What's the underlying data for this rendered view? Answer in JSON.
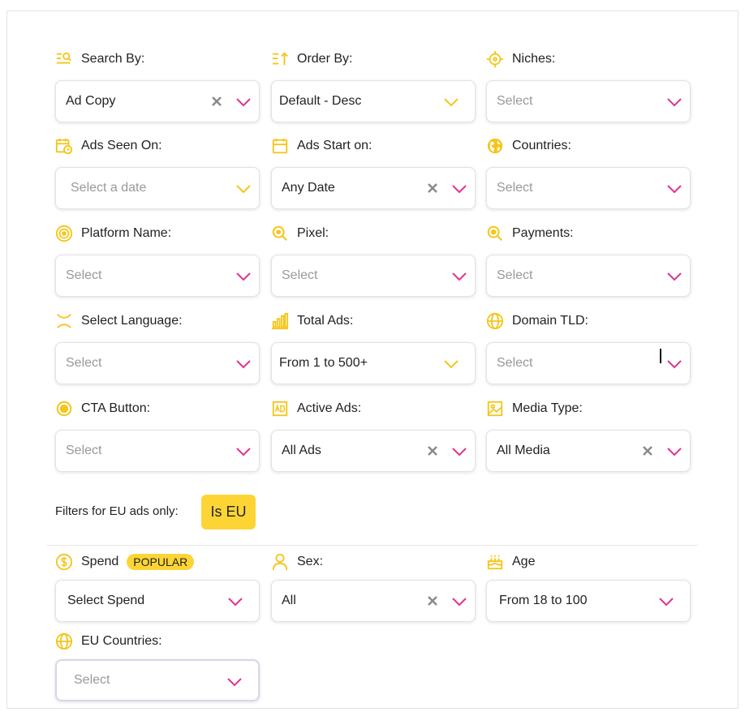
{
  "colors": {
    "accent_yellow": "#fcd535",
    "icon_yellow": "#f5c518",
    "chevron_pink": "#e0338f",
    "clear_gray": "#8a8a8a"
  },
  "filters": {
    "search_by": {
      "label": "Search By:",
      "value": "Ad Copy",
      "icon": "search-list-icon"
    },
    "order_by": {
      "label": "Order By:",
      "value": "Default - Desc",
      "icon": "sort-icon"
    },
    "niches": {
      "label": "Niches:",
      "placeholder": "Select",
      "icon": "crosshair-icon"
    },
    "ads_seen_on": {
      "label": "Ads Seen On:",
      "placeholder": "Select a date",
      "icon": "calendar-clock-icon"
    },
    "ads_start_on": {
      "label": "Ads Start on:",
      "value": "Any Date",
      "icon": "calendar-icon"
    },
    "countries": {
      "label": "Countries:",
      "placeholder": "Select",
      "icon": "globe-americas-icon"
    },
    "platform_name": {
      "label": "Platform Name:",
      "placeholder": "Select",
      "icon": "target-icon"
    },
    "pixel": {
      "label": "Pixel:",
      "placeholder": "Select",
      "icon": "pixel-search-icon"
    },
    "payments": {
      "label": "Payments:",
      "placeholder": "Select",
      "icon": "payments-search-icon"
    },
    "select_language": {
      "label": "Select Language:",
      "placeholder": "Select",
      "icon": "language-icon"
    },
    "total_ads": {
      "label": "Total Ads:",
      "value": "From 1 to 500+",
      "icon": "bar-chart-icon"
    },
    "domain_tld": {
      "label": "Domain TLD:",
      "placeholder": "Select",
      "icon": "globe-icon"
    },
    "cta_button": {
      "label": "CTA Button:",
      "placeholder": "Select",
      "icon": "radio-button-icon"
    },
    "active_ads": {
      "label": "Active Ads:",
      "value": "All Ads",
      "icon": "ad-icon"
    },
    "media_type": {
      "label": "Media Type:",
      "value": "All Media",
      "icon": "image-icon"
    }
  },
  "eu": {
    "filters_label": "Filters for EU ads only:",
    "is_eu_button": "Is EU",
    "spend": {
      "label": "Spend",
      "badge": "POPULAR",
      "value": "Select Spend",
      "icon": "dollar-coin-icon"
    },
    "sex": {
      "label": "Sex:",
      "value": "All",
      "icon": "person-icon"
    },
    "age": {
      "label": "Age",
      "value": "From 18 to 100",
      "icon": "birthday-cake-icon"
    },
    "eu_countries": {
      "label": "EU Countries:",
      "placeholder": "Select",
      "icon": "globe-icon"
    }
  }
}
